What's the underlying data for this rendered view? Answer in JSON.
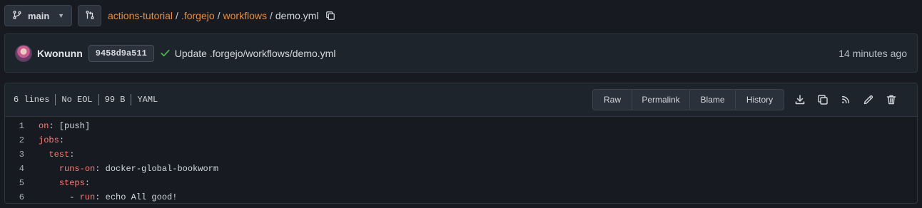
{
  "branch": {
    "label": "main"
  },
  "breadcrumb": {
    "parts": [
      "actions-tutorial",
      ".forgejo",
      "workflows"
    ],
    "separator": "/",
    "current": "demo.yml"
  },
  "commit": {
    "author": "Kwonunn",
    "sha": "9458d9a511",
    "message": "Update .forgejo/workflows/demo.yml",
    "time": "14 minutes ago",
    "status": "success"
  },
  "file": {
    "meta": [
      "6 lines",
      "No EOL",
      "99 B",
      "YAML"
    ],
    "buttons": [
      "Raw",
      "Permalink",
      "Blame",
      "History"
    ],
    "icons": [
      "download-icon",
      "copy-content-icon",
      "rss-icon",
      "edit-icon",
      "delete-icon"
    ],
    "code": [
      {
        "num": "1",
        "indent": "",
        "key": "on",
        "rest": ": [push]"
      },
      {
        "num": "2",
        "indent": "",
        "key": "jobs",
        "rest": ":"
      },
      {
        "num": "3",
        "indent": "  ",
        "key": "test",
        "rest": ":"
      },
      {
        "num": "4",
        "indent": "    ",
        "key": "runs-on",
        "rest": ": docker-global-bookworm"
      },
      {
        "num": "5",
        "indent": "    ",
        "key": "steps",
        "rest": ":"
      },
      {
        "num": "6",
        "indent": "      - ",
        "key": "run",
        "rest": ": echo All good!"
      }
    ]
  },
  "colors": {
    "link": "#e98c3d",
    "success": "#4cae4f",
    "yaml_key": "#ff7b72"
  }
}
